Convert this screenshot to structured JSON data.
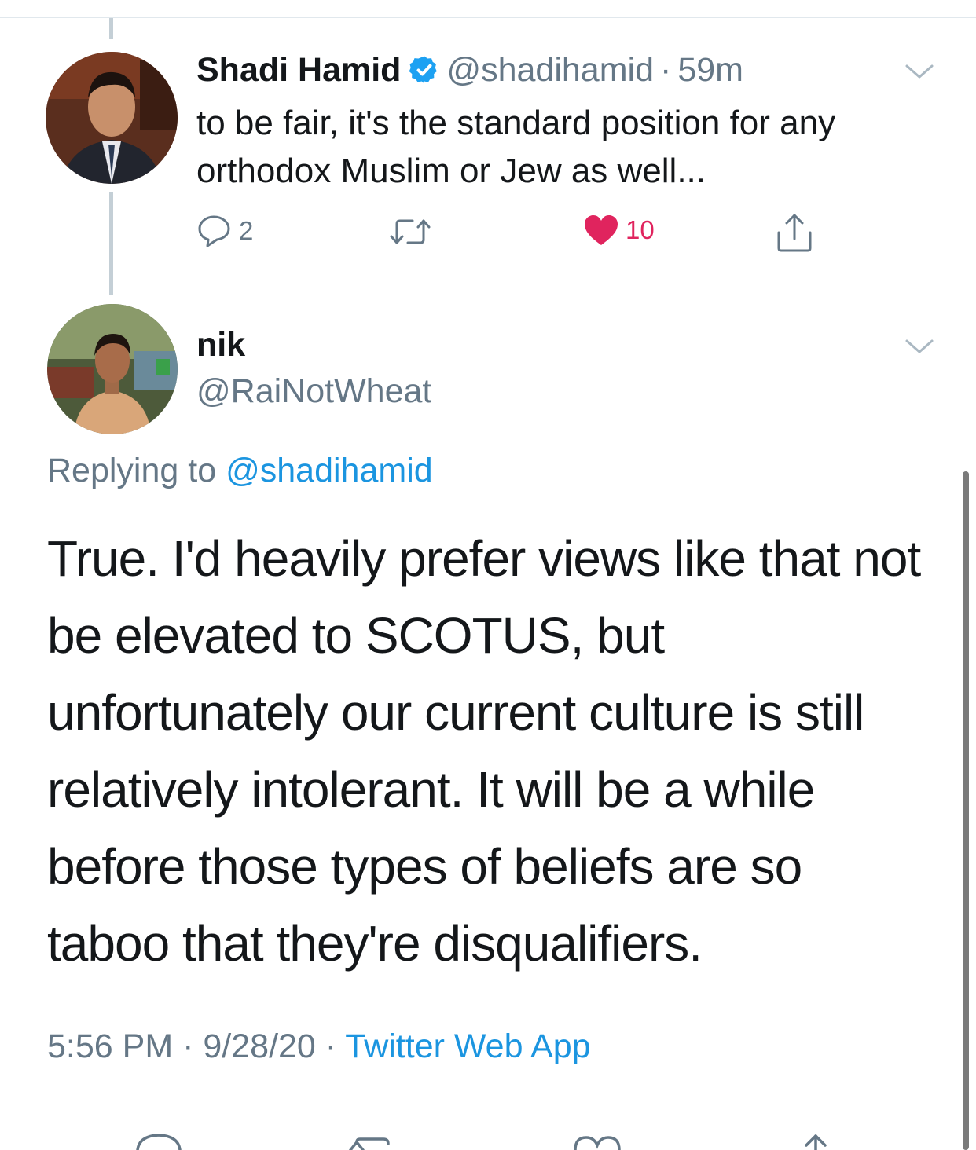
{
  "tweet1": {
    "author_name": "Shadi Hamid",
    "handle": "@shadihamid",
    "separator": "·",
    "time": "59m",
    "text": "to be fair, it's the standard position for any orthodox Muslim or Jew as well...",
    "reply_count": "2",
    "like_count": "10"
  },
  "tweet2": {
    "author_name": "nik",
    "handle": "@RaiNotWheat",
    "replying_label": "Replying to",
    "replying_handle": "@shadihamid",
    "text": "True. I'd heavily prefer views like that not be elevated to SCOTUS, but unfortunately our current culture is still relatively intolerant. It will be a while before those types of beliefs are so taboo that they're disqualifiers.",
    "time": "5:56 PM",
    "date": "9/28/20",
    "separator": "·",
    "source": "Twitter Web App"
  },
  "colors": {
    "text_primary": "#14171a",
    "text_secondary": "#657786",
    "link": "#1b95e0",
    "like": "#e0245e",
    "verified": "#1da1f2",
    "divider": "#e1e8ed"
  },
  "icons": [
    "verified-badge-icon",
    "chevron-down-icon",
    "reply-icon",
    "retweet-icon",
    "heart-icon",
    "share-icon"
  ]
}
